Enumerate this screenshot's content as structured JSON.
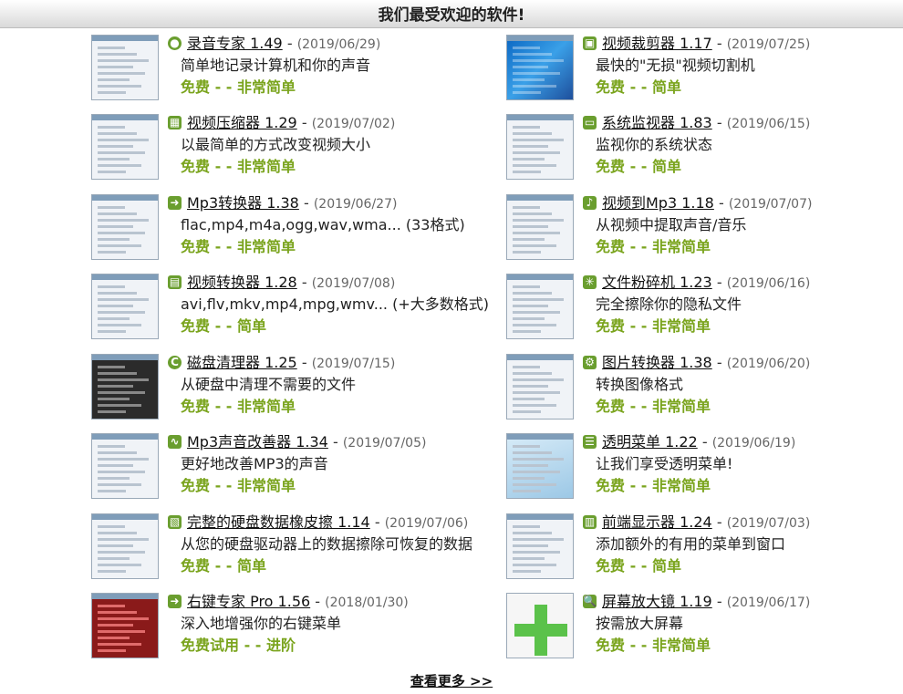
{
  "header": {
    "title": "我们最受欢迎的软件!"
  },
  "left": [
    {
      "name": "录音专家 1.49",
      "date": "(2019/06/29)",
      "desc": "简单地记录计算机和你的声音",
      "tags": "免费 - - 非常简单",
      "icon": "record-icon"
    },
    {
      "name": "视频压缩器 1.29",
      "date": "(2019/07/02)",
      "desc": "以最简单的方式改变视频大小",
      "tags": "免费 - - 非常简单",
      "icon": "video-compress-icon"
    },
    {
      "name": "Mp3转换器 1.38",
      "date": "(2019/06/27)",
      "desc": "flac,mp4,m4a,ogg,wav,wma... (33格式)",
      "tags": "免费 - - 非常简单",
      "icon": "arrow-right-icon"
    },
    {
      "name": "视频转换器 1.28",
      "date": "(2019/07/08)",
      "desc": "avi,flv,mkv,mp4,mpg,wmv... (+大多数格式)",
      "tags": "免费 - - 简单",
      "icon": "video-convert-icon"
    },
    {
      "name": "磁盘清理器 1.25",
      "date": "(2019/07/15)",
      "desc": "从硬盘中清理不需要的文件",
      "tags": "免费 - - 非常简单",
      "icon": "disk-clean-icon"
    },
    {
      "name": "Mp3声音改善器 1.34",
      "date": "(2019/07/05)",
      "desc": "更好地改善MP3的声音",
      "tags": "免费 - - 非常简单",
      "icon": "wave-icon"
    },
    {
      "name": "完整的硬盘数据橡皮擦 1.14",
      "date": "(2019/07/06)",
      "desc": "从您的硬盘驱动器上的数据擦除可恢复的数据",
      "tags": "免费 - - 简单",
      "icon": "eraser-icon"
    },
    {
      "name": "右键专家 Pro 1.56",
      "date": "(2018/01/30)",
      "desc": "深入地增强你的右键菜单",
      "tags": "免费试用 - - 进阶",
      "icon": "arrow-right-icon"
    }
  ],
  "right": [
    {
      "name": "视频裁剪器 1.17",
      "date": "(2019/07/25)",
      "desc": "最快的\"无损\"视频切割机",
      "tags": "免费 - - 简单",
      "icon": "video-cut-icon"
    },
    {
      "name": "系统监视器 1.83",
      "date": "(2019/06/15)",
      "desc": "监视你的系统状态",
      "tags": "免费 - - 简单",
      "icon": "monitor-icon"
    },
    {
      "name": "视频到Mp3 1.18",
      "date": "(2019/07/07)",
      "desc": "从视频中提取声音/音乐",
      "tags": "免费 - - 非常简单",
      "icon": "video-mp3-icon"
    },
    {
      "name": "文件粉碎机 1.23",
      "date": "(2019/06/16)",
      "desc": "完全擦除你的隐私文件",
      "tags": "免费 - - 非常简单",
      "icon": "shredder-icon"
    },
    {
      "name": "图片转换器 1.38",
      "date": "(2019/06/20)",
      "desc": "转换图像格式",
      "tags": "免费 - - 非常简单",
      "icon": "image-convert-icon"
    },
    {
      "name": "透明菜单 1.22",
      "date": "(2019/06/19)",
      "desc": "让我们享受透明菜单!",
      "tags": "免费 - - 非常简单",
      "icon": "transparent-menu-icon"
    },
    {
      "name": "前端显示器 1.24",
      "date": "(2019/07/03)",
      "desc": "添加额外的有用的菜单到窗口",
      "tags": "免费 - - 简单",
      "icon": "front-display-icon"
    },
    {
      "name": "屏幕放大镜 1.19",
      "date": "(2019/06/17)",
      "desc": "按需放大屏幕",
      "tags": "免费 - - 非常简单",
      "icon": "magnifier-icon"
    }
  ],
  "footer": {
    "more_label": "查看更多 >>"
  }
}
